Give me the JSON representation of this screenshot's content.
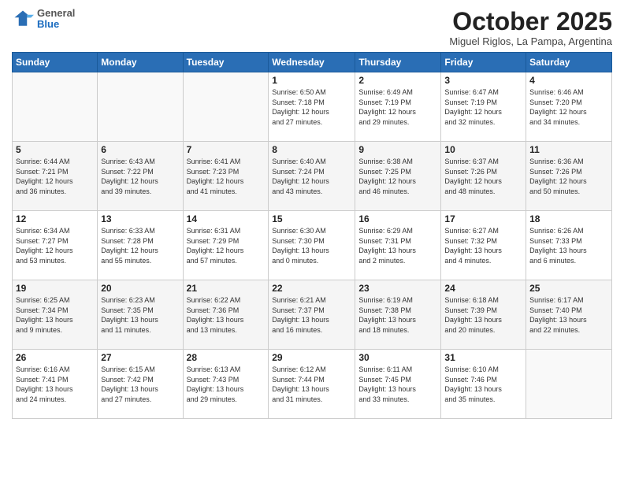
{
  "logo": {
    "general": "General",
    "blue": "Blue"
  },
  "header": {
    "month": "October 2025",
    "location": "Miguel Riglos, La Pampa, Argentina"
  },
  "weekdays": [
    "Sunday",
    "Monday",
    "Tuesday",
    "Wednesday",
    "Thursday",
    "Friday",
    "Saturday"
  ],
  "weeks": [
    [
      {
        "day": "",
        "info": ""
      },
      {
        "day": "",
        "info": ""
      },
      {
        "day": "",
        "info": ""
      },
      {
        "day": "1",
        "info": "Sunrise: 6:50 AM\nSunset: 7:18 PM\nDaylight: 12 hours\nand 27 minutes."
      },
      {
        "day": "2",
        "info": "Sunrise: 6:49 AM\nSunset: 7:19 PM\nDaylight: 12 hours\nand 29 minutes."
      },
      {
        "day": "3",
        "info": "Sunrise: 6:47 AM\nSunset: 7:19 PM\nDaylight: 12 hours\nand 32 minutes."
      },
      {
        "day": "4",
        "info": "Sunrise: 6:46 AM\nSunset: 7:20 PM\nDaylight: 12 hours\nand 34 minutes."
      }
    ],
    [
      {
        "day": "5",
        "info": "Sunrise: 6:44 AM\nSunset: 7:21 PM\nDaylight: 12 hours\nand 36 minutes."
      },
      {
        "day": "6",
        "info": "Sunrise: 6:43 AM\nSunset: 7:22 PM\nDaylight: 12 hours\nand 39 minutes."
      },
      {
        "day": "7",
        "info": "Sunrise: 6:41 AM\nSunset: 7:23 PM\nDaylight: 12 hours\nand 41 minutes."
      },
      {
        "day": "8",
        "info": "Sunrise: 6:40 AM\nSunset: 7:24 PM\nDaylight: 12 hours\nand 43 minutes."
      },
      {
        "day": "9",
        "info": "Sunrise: 6:38 AM\nSunset: 7:25 PM\nDaylight: 12 hours\nand 46 minutes."
      },
      {
        "day": "10",
        "info": "Sunrise: 6:37 AM\nSunset: 7:26 PM\nDaylight: 12 hours\nand 48 minutes."
      },
      {
        "day": "11",
        "info": "Sunrise: 6:36 AM\nSunset: 7:26 PM\nDaylight: 12 hours\nand 50 minutes."
      }
    ],
    [
      {
        "day": "12",
        "info": "Sunrise: 6:34 AM\nSunset: 7:27 PM\nDaylight: 12 hours\nand 53 minutes."
      },
      {
        "day": "13",
        "info": "Sunrise: 6:33 AM\nSunset: 7:28 PM\nDaylight: 12 hours\nand 55 minutes."
      },
      {
        "day": "14",
        "info": "Sunrise: 6:31 AM\nSunset: 7:29 PM\nDaylight: 12 hours\nand 57 minutes."
      },
      {
        "day": "15",
        "info": "Sunrise: 6:30 AM\nSunset: 7:30 PM\nDaylight: 13 hours\nand 0 minutes."
      },
      {
        "day": "16",
        "info": "Sunrise: 6:29 AM\nSunset: 7:31 PM\nDaylight: 13 hours\nand 2 minutes."
      },
      {
        "day": "17",
        "info": "Sunrise: 6:27 AM\nSunset: 7:32 PM\nDaylight: 13 hours\nand 4 minutes."
      },
      {
        "day": "18",
        "info": "Sunrise: 6:26 AM\nSunset: 7:33 PM\nDaylight: 13 hours\nand 6 minutes."
      }
    ],
    [
      {
        "day": "19",
        "info": "Sunrise: 6:25 AM\nSunset: 7:34 PM\nDaylight: 13 hours\nand 9 minutes."
      },
      {
        "day": "20",
        "info": "Sunrise: 6:23 AM\nSunset: 7:35 PM\nDaylight: 13 hours\nand 11 minutes."
      },
      {
        "day": "21",
        "info": "Sunrise: 6:22 AM\nSunset: 7:36 PM\nDaylight: 13 hours\nand 13 minutes."
      },
      {
        "day": "22",
        "info": "Sunrise: 6:21 AM\nSunset: 7:37 PM\nDaylight: 13 hours\nand 16 minutes."
      },
      {
        "day": "23",
        "info": "Sunrise: 6:19 AM\nSunset: 7:38 PM\nDaylight: 13 hours\nand 18 minutes."
      },
      {
        "day": "24",
        "info": "Sunrise: 6:18 AM\nSunset: 7:39 PM\nDaylight: 13 hours\nand 20 minutes."
      },
      {
        "day": "25",
        "info": "Sunrise: 6:17 AM\nSunset: 7:40 PM\nDaylight: 13 hours\nand 22 minutes."
      }
    ],
    [
      {
        "day": "26",
        "info": "Sunrise: 6:16 AM\nSunset: 7:41 PM\nDaylight: 13 hours\nand 24 minutes."
      },
      {
        "day": "27",
        "info": "Sunrise: 6:15 AM\nSunset: 7:42 PM\nDaylight: 13 hours\nand 27 minutes."
      },
      {
        "day": "28",
        "info": "Sunrise: 6:13 AM\nSunset: 7:43 PM\nDaylight: 13 hours\nand 29 minutes."
      },
      {
        "day": "29",
        "info": "Sunrise: 6:12 AM\nSunset: 7:44 PM\nDaylight: 13 hours\nand 31 minutes."
      },
      {
        "day": "30",
        "info": "Sunrise: 6:11 AM\nSunset: 7:45 PM\nDaylight: 13 hours\nand 33 minutes."
      },
      {
        "day": "31",
        "info": "Sunrise: 6:10 AM\nSunset: 7:46 PM\nDaylight: 13 hours\nand 35 minutes."
      },
      {
        "day": "",
        "info": ""
      }
    ]
  ]
}
